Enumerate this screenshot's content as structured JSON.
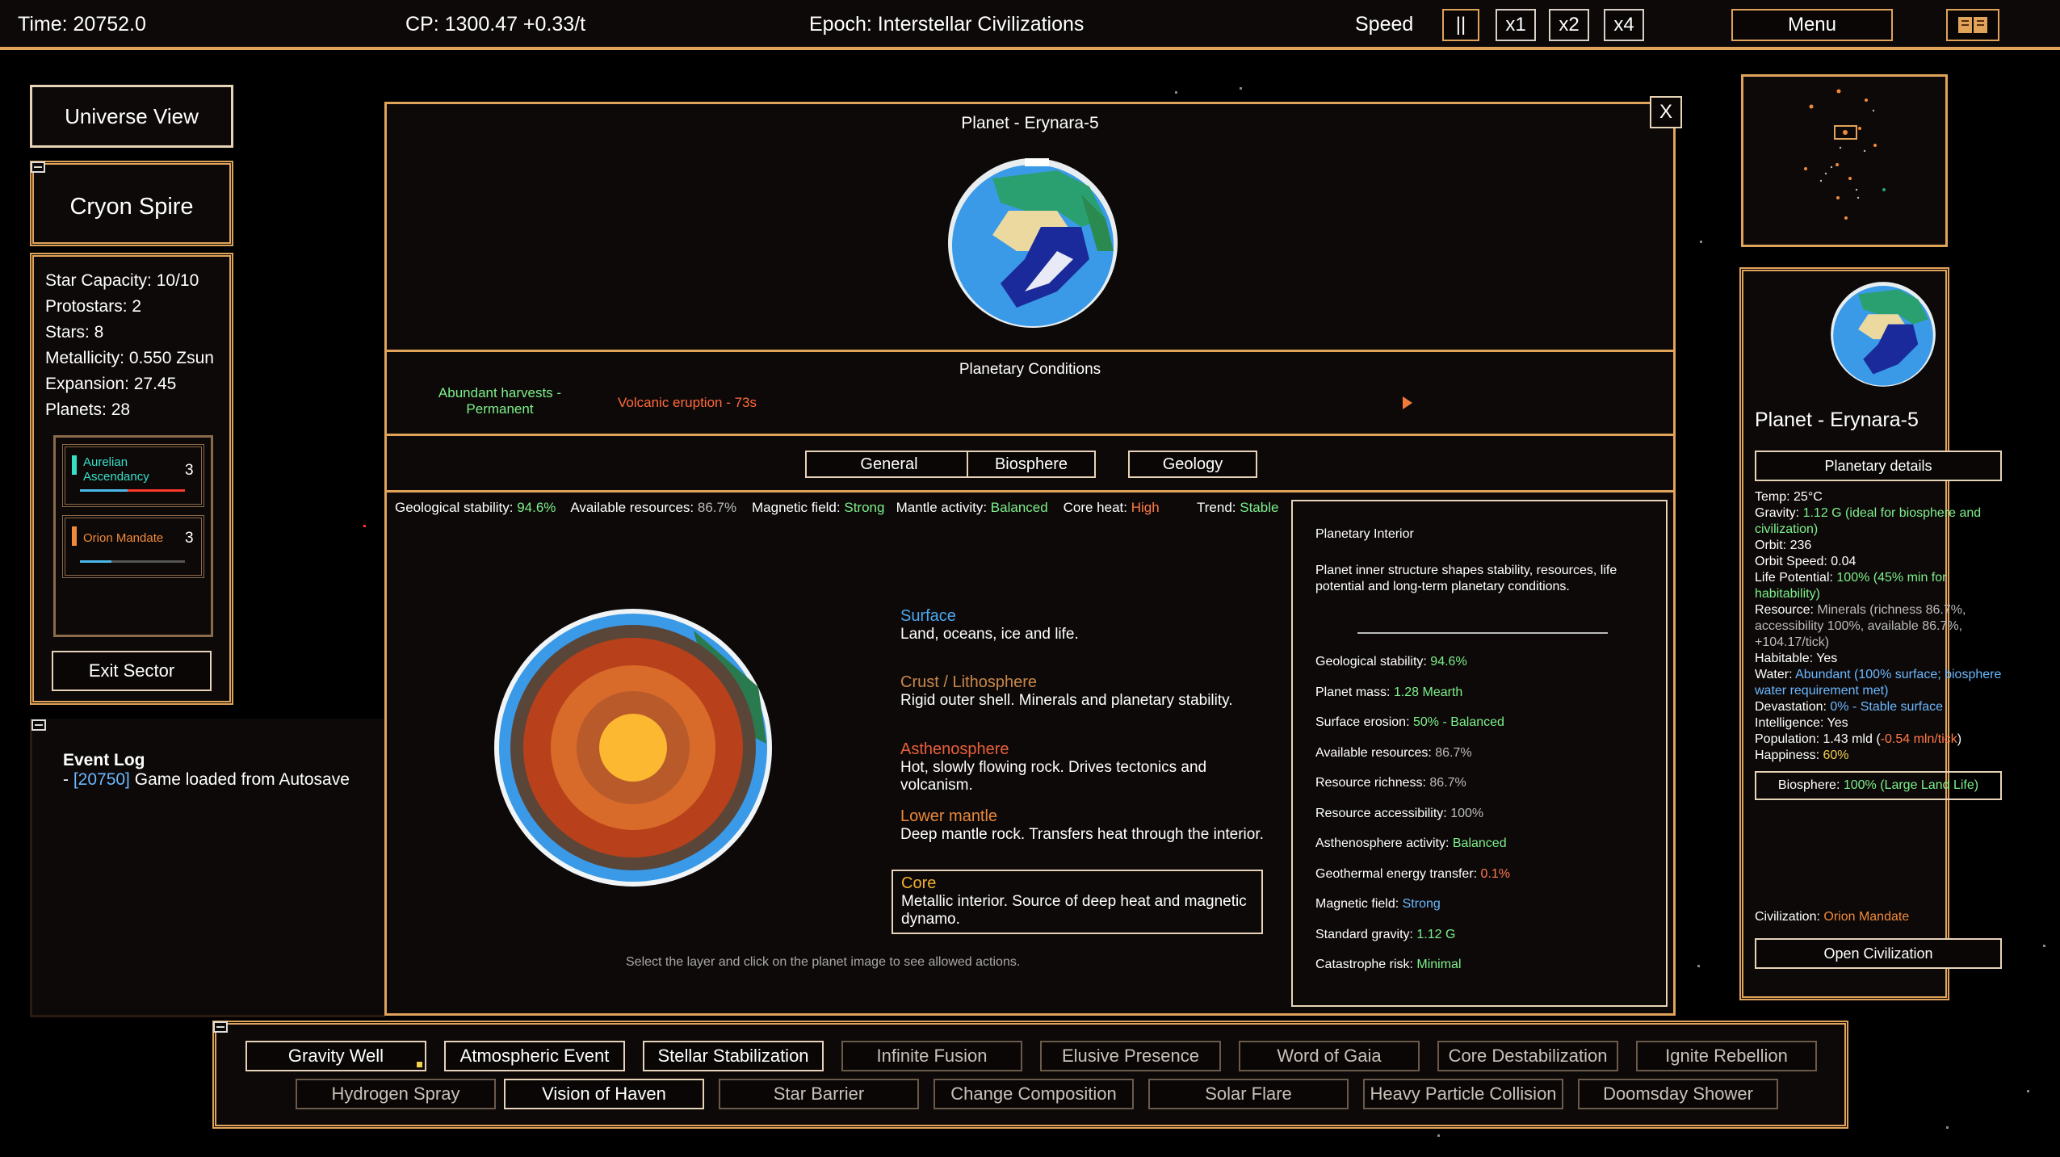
{
  "topbar": {
    "time": "Time: 20752.0",
    "cp": "CP: 1300.47 +0.33/t",
    "epoch": "Epoch: Interstellar Civilizations",
    "speed_label": "Speed",
    "pause": "||",
    "x1": "x1",
    "x2": "x2",
    "x4": "x4",
    "menu": "Menu"
  },
  "left": {
    "universe_view": "Universe View",
    "sector_name": "Cryon Spire",
    "stats": [
      "Star Capacity: 10/10",
      "Protostars: 2",
      "Stars: 8",
      "Metallicity: 0.550 Zsun",
      "Expansion: 27.45",
      "Planets: 28"
    ],
    "civs": [
      {
        "name": "Aurelian Ascendancy",
        "count": "3",
        "color": "#36e0c8"
      },
      {
        "name": "Orion Mandate",
        "count": "3",
        "color": "#f08a3a"
      }
    ],
    "exit_sector": "Exit Sector"
  },
  "event_log": {
    "title": "Event Log",
    "entry_prefix": "- ",
    "entry_time": "[20750]",
    "entry_text": " Game loaded from Autosave"
  },
  "planet_window": {
    "title": "Planet - Erynara-5",
    "close": "X",
    "conditions_title": "Planetary Conditions",
    "condition_good": "Abundant harvests - Permanent",
    "condition_bad": "Volcanic eruption - 73s",
    "tabs": [
      "General",
      "Biosphere",
      "Geology"
    ],
    "geo_stats": {
      "stability_label": "Geological stability:",
      "stability_value": "94.6%",
      "resources_label": "Available resources:",
      "resources_value": "86.7%",
      "magnetic_label": "Magnetic field:",
      "magnetic_value": "Strong",
      "mantle_label": "Mantle activity:",
      "mantle_value": "Balanced",
      "core_label": "Core heat:",
      "core_value": "High",
      "trend_label": "Trend:",
      "trend_value": "Stable"
    },
    "layers": [
      {
        "name": "Surface",
        "desc": "Land, oceans, ice and life.",
        "color": "#4aa8f0"
      },
      {
        "name": "Crust / Lithosphere",
        "desc": "Rigid outer shell. Minerals and planetary stability.",
        "color": "#c8884a"
      },
      {
        "name": "Asthenosphere",
        "desc": "Hot, slowly flowing rock. Drives tectonics and volcanism.",
        "color": "#e8603a"
      },
      {
        "name": "Lower mantle",
        "desc": "Deep mantle rock. Transfers heat through the interior.",
        "color": "#e8883a"
      },
      {
        "name": "Core",
        "desc": "Metallic interior. Source of deep heat and magnetic dynamo.",
        "color": "#f0b030"
      }
    ],
    "hint": "Select the layer and click on the planet image to see allowed actions.",
    "interior": {
      "title": "Planetary Interior",
      "desc": "Planet inner structure shapes stability, resources, life potential and long-term planetary conditions.",
      "rows": [
        {
          "label": "Geological stability:",
          "value": "94.6%",
          "color": "#7cf08a"
        },
        {
          "label": "Planet mass:",
          "value": "1.28 Mearth",
          "color": "#7cf08a"
        },
        {
          "label": "Surface erosion:",
          "value": "50% - Balanced",
          "color": "#7cf08a"
        },
        {
          "label": "Available resources:",
          "value": "86.7%",
          "color": "#bbbbbb"
        },
        {
          "label": "Resource richness:",
          "value": "86.7%",
          "color": "#bbbbbb"
        },
        {
          "label": "Resource accessibility:",
          "value": "100%",
          "color": "#bbbbbb"
        },
        {
          "label": "Asthenosphere activity:",
          "value": "Balanced",
          "color": "#7cf08a"
        },
        {
          "label": "Geothermal energy transfer:",
          "value": "0.1%",
          "color": "#ff7a4a"
        },
        {
          "label": "Magnetic field:",
          "value": "Strong",
          "color": "#6ab8ff"
        },
        {
          "label": "Standard gravity:",
          "value": "1.12 G",
          "color": "#7cf08a"
        },
        {
          "label": "Catastrophe risk:",
          "value": "Minimal",
          "color": "#7cf08a"
        }
      ]
    }
  },
  "right": {
    "planet_name": "Planet - Erynara-5",
    "details_button": "Planetary details",
    "temp": "Temp: 25°C",
    "gravity_label": "Gravity:",
    "gravity_value": "1.12 G (ideal for biosphere and civilization)",
    "orbit": "Orbit: 236",
    "orbit_speed": "Orbit Speed: 0.04",
    "life_label": "Life Potential:",
    "life_value": "100% (45% min for habitability)",
    "resource_label": "Resource:",
    "resource_value": "Minerals (richness 86.7%, accessibility 100%, available 86.7%, +104.17/tick)",
    "habitable": "Habitable: Yes",
    "water_label": "Water:",
    "water_value": "Abundant (100% surface; biosphere water requirement met)",
    "devastation_label": "Devastation:",
    "devastation_value": "0% - Stable surface",
    "intelligence": "Intelligence: Yes",
    "population_label": "Population: 1.43 mld (",
    "population_change": "-0.54 mln/tick",
    "population_end": ")",
    "happiness_label": "Happiness:",
    "happiness_value": "60%",
    "biosphere_label": "Biosphere:",
    "biosphere_value": "100% (Large Land Life)",
    "civilization_label": "Civilization:",
    "civilization_value": "Orion Mandate",
    "open_civ": "Open Civilization"
  },
  "powers": {
    "row1": [
      "Gravity Well",
      "Atmospheric Event",
      "Stellar Stabilization",
      "Infinite Fusion",
      "Elusive Presence",
      "Word of Gaia",
      "Core Destabilization",
      "Ignite Rebellion"
    ],
    "row2": [
      "Hydrogen Spray",
      "Vision of Haven",
      "Star Barrier",
      "Change Composition",
      "Solar Flare",
      "Heavy Particle Collision",
      "Doomsday Shower"
    ]
  }
}
